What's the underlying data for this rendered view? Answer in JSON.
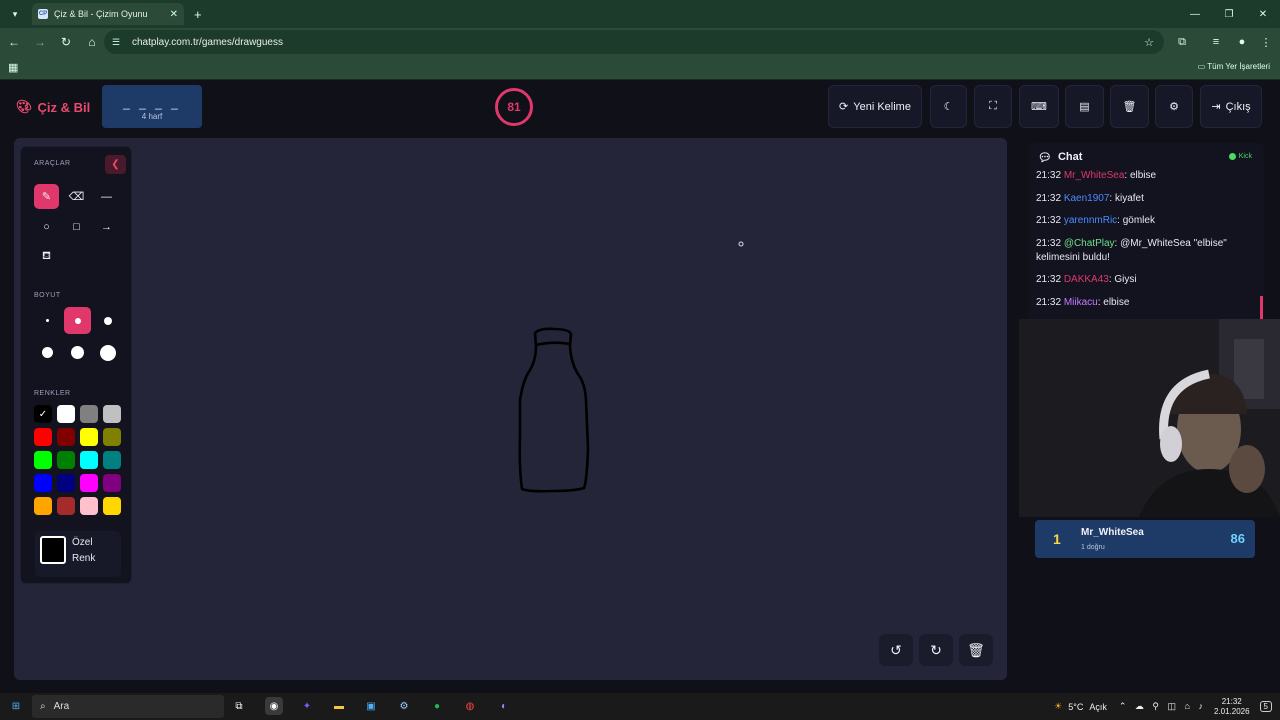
{
  "browser": {
    "tab_title": "Çiz & Bil - Çizim Oyunu",
    "tab_favicon": "CP",
    "url": "chatplay.com.tr/games/drawguess",
    "bookmarks_label": "Tüm Yer İşaretleri"
  },
  "header": {
    "logo": "Çiz & Bil",
    "word_mask": "_ _ _ _",
    "word_hint": "4 harf",
    "timer": "81",
    "new_word_label": "Yeni Kelime",
    "exit_label": "Çıkış"
  },
  "tools": {
    "tools_title": "ARAÇLAR",
    "size_title": "BOYUT",
    "colors_title": "RENKLER",
    "custom_color_line1": "Özel",
    "custom_color_line2": "Renk",
    "palette": [
      "#000000",
      "#ffffff",
      "#808080",
      "#c0c0c0",
      "#ff0000",
      "#800000",
      "#ffff00",
      "#808000",
      "#00ff00",
      "#008000",
      "#00ffff",
      "#008080",
      "#0000ff",
      "#000080",
      "#ff00ff",
      "#800080",
      "#ffa500",
      "#a52a2a",
      "#ffc0cb",
      "#ffd700"
    ]
  },
  "chat": {
    "title": "Chat",
    "platform": "Kick",
    "messages": [
      {
        "time": "21:32",
        "user": "Mr_WhiteSea",
        "color": "#e0386a",
        "text": ": elbise"
      },
      {
        "time": "21:32",
        "user": "Kaen1907",
        "color": "#4a8cff",
        "text": ": kiyafet"
      },
      {
        "time": "21:32",
        "user": "yarennmRic",
        "color": "#4a8cff",
        "text": ": gömlek"
      },
      {
        "time": "21:32",
        "user": "@ChatPlay",
        "color": "#6fe08a",
        "text": ": @Mr_WhiteSea \"elbise\" kelimesini buldu!"
      },
      {
        "time": "21:32",
        "user": "DAKKA43",
        "color": "#e0386a",
        "text": ": Giysi"
      },
      {
        "time": "21:32",
        "user": "Miikacu",
        "color": "#c67bff",
        "text": ": elbise"
      }
    ]
  },
  "leaderboard": {
    "rank": "1",
    "name": "Mr_WhiteSea",
    "sub": "1 doğru",
    "score": "86"
  },
  "taskbar": {
    "search_label": "Ara",
    "weather": "5°C",
    "weather_desc": "Açık",
    "time": "21:32",
    "date": "2.01.2026",
    "notifications": "5"
  }
}
